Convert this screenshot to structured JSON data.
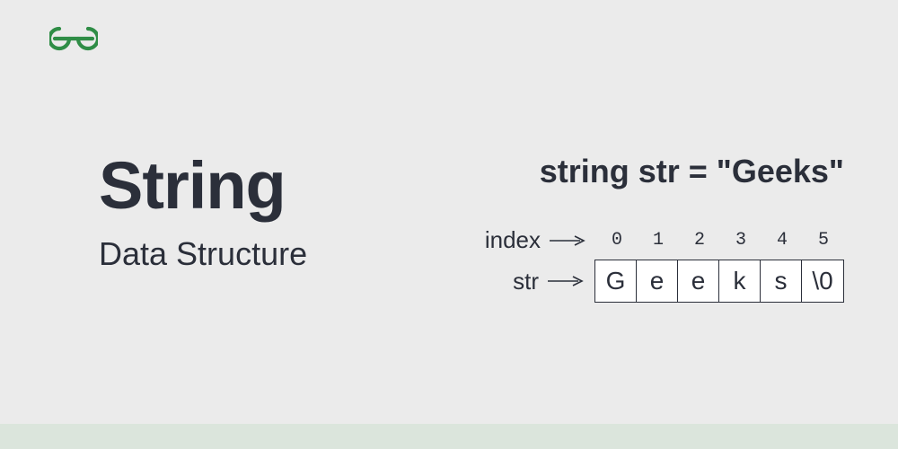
{
  "brand": {
    "color": "#2f8d46"
  },
  "heading": {
    "title": "String",
    "subtitle": "Data Structure"
  },
  "code": {
    "declaration": "string str = \"Geeks\""
  },
  "labels": {
    "index": "index",
    "str": "str"
  },
  "indices": [
    "0",
    "1",
    "2",
    "3",
    "4",
    "5"
  ],
  "chars": [
    "G",
    "e",
    "e",
    "k",
    "s",
    "\\0"
  ],
  "colors": {
    "text": "#2b2f3a",
    "bg": "#ebebeb",
    "footer": "#dbe5dc",
    "cellbg": "#ffffff"
  }
}
